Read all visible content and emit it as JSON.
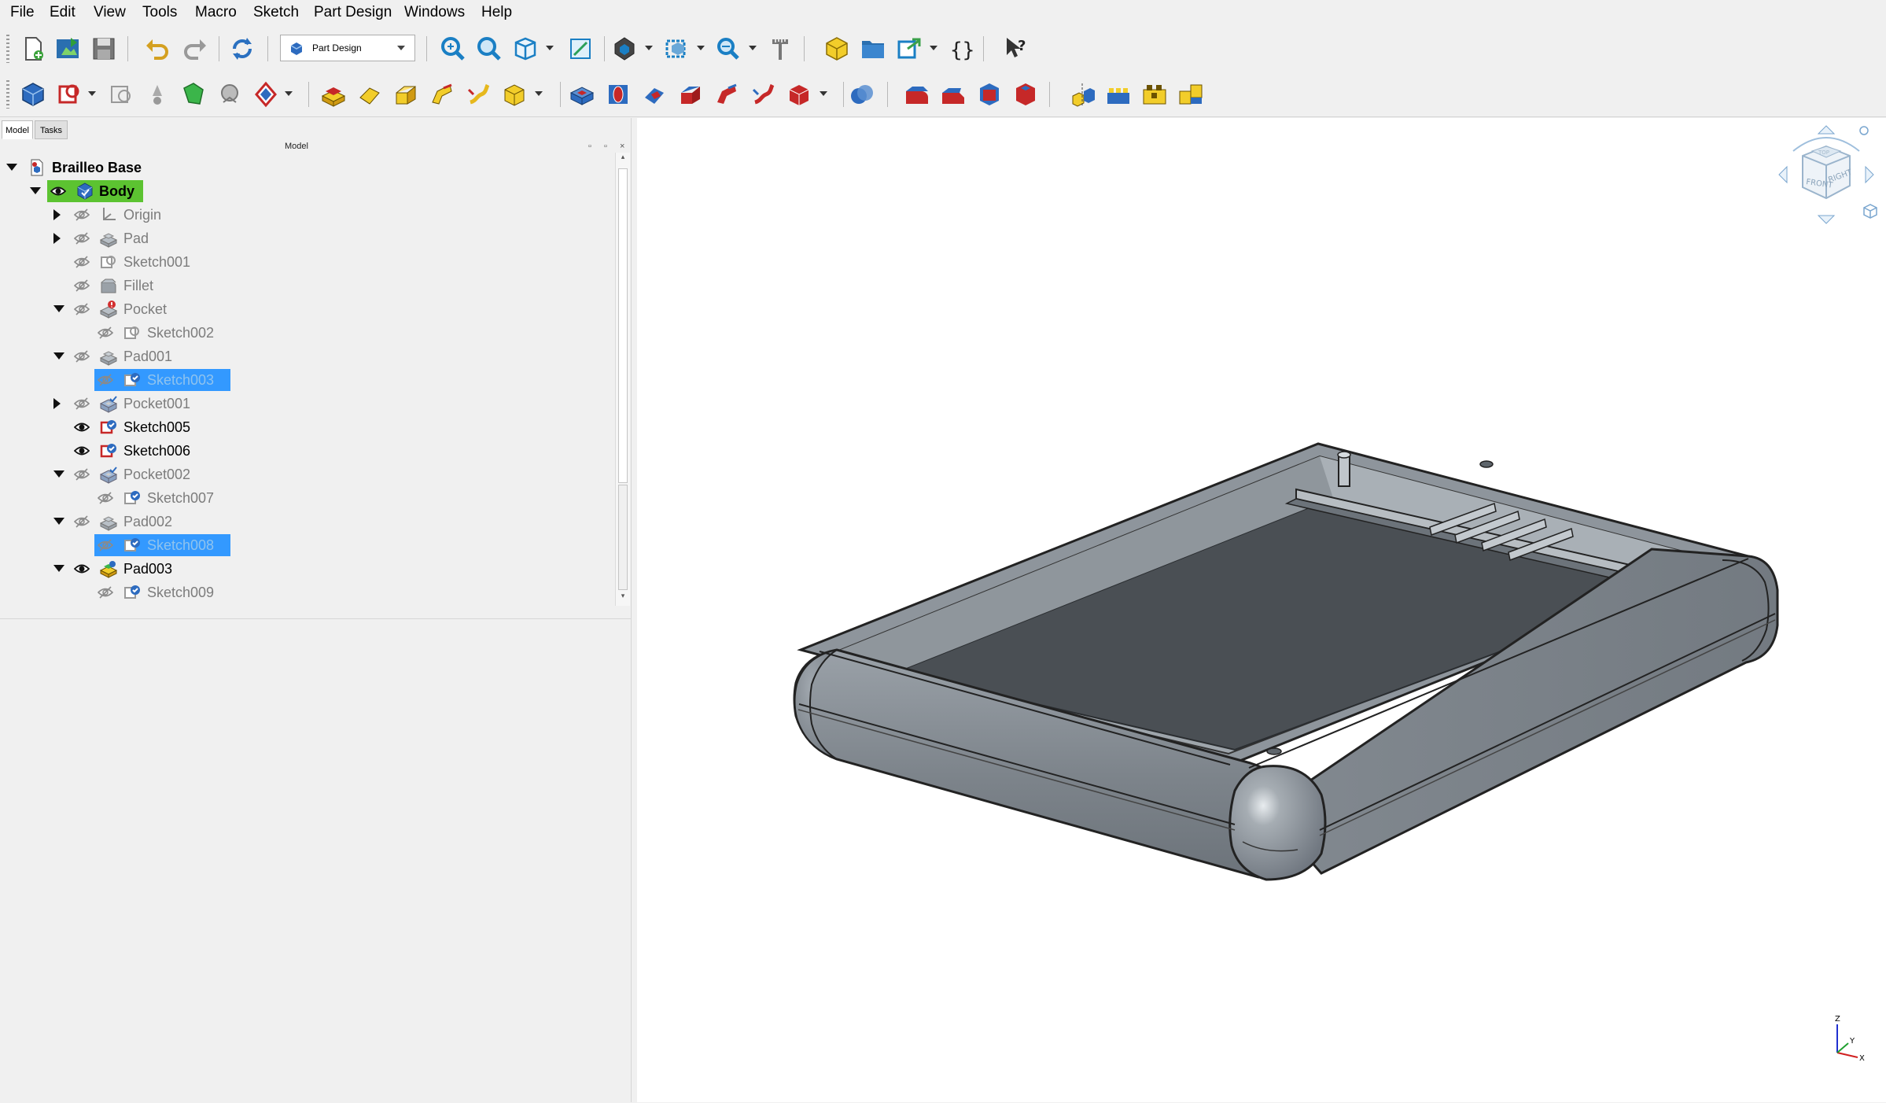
{
  "menu": [
    "File",
    "Edit",
    "View",
    "Tools",
    "Macro",
    "Sketch",
    "Part Design",
    "Windows",
    "Help"
  ],
  "workbench": {
    "selected": "Part Design"
  },
  "panel": {
    "tabs": [
      "Model",
      "Tasks"
    ],
    "title": "Model",
    "controls": [
      "▫",
      "▫",
      "×"
    ]
  },
  "tree": [
    {
      "label": "Brailleo Base",
      "level": 0,
      "expander": "open",
      "icon": "document-icon",
      "visibility": "none",
      "style": "bold"
    },
    {
      "label": "Body",
      "level": 1,
      "expander": "open",
      "icon": "body-icon",
      "visibility": "visible",
      "style": "bold",
      "highlight": "active"
    },
    {
      "label": "Origin",
      "level": 2,
      "expander": "closed",
      "icon": "origin-icon",
      "visibility": "hidden",
      "style": "dim"
    },
    {
      "label": "Pad",
      "level": 2,
      "expander": "closed",
      "icon": "pad-icon",
      "visibility": "hidden",
      "style": "dim"
    },
    {
      "label": "Sketch001",
      "level": 2,
      "expander": "none",
      "icon": "sketch-icon",
      "visibility": "hidden",
      "style": "dim"
    },
    {
      "label": "Fillet",
      "level": 2,
      "expander": "none",
      "icon": "fillet-icon",
      "visibility": "hidden",
      "style": "dim"
    },
    {
      "label": "Pocket",
      "level": 2,
      "expander": "open",
      "icon": "pocket-error-icon",
      "visibility": "hidden",
      "style": "dim"
    },
    {
      "label": "Sketch002",
      "level": 3,
      "expander": "none",
      "icon": "sketch-icon",
      "visibility": "hidden",
      "style": "dim"
    },
    {
      "label": "Pad001",
      "level": 2,
      "expander": "open",
      "icon": "pad-icon",
      "visibility": "hidden",
      "style": "dim"
    },
    {
      "label": "Sketch003",
      "level": 3,
      "expander": "none",
      "icon": "sketch-check-icon",
      "visibility": "hidden",
      "style": "dim",
      "highlight": "selected"
    },
    {
      "label": "Pocket001",
      "level": 2,
      "expander": "closed",
      "icon": "pocket-icon",
      "visibility": "hidden",
      "style": "dim"
    },
    {
      "label": "Sketch005",
      "level": 2,
      "expander": "none",
      "icon": "sketch-red-icon",
      "visibility": "visible",
      "style": "normal"
    },
    {
      "label": "Sketch006",
      "level": 2,
      "expander": "none",
      "icon": "sketch-red-icon",
      "visibility": "visible",
      "style": "normal"
    },
    {
      "label": "Pocket002",
      "level": 2,
      "expander": "open",
      "icon": "pocket-icon",
      "visibility": "hidden",
      "style": "dim"
    },
    {
      "label": "Sketch007",
      "level": 3,
      "expander": "none",
      "icon": "sketch-check-icon",
      "visibility": "hidden",
      "style": "dim"
    },
    {
      "label": "Pad002",
      "level": 2,
      "expander": "open",
      "icon": "pad-icon",
      "visibility": "hidden",
      "style": "dim"
    },
    {
      "label": "Sketch008",
      "level": 3,
      "expander": "none",
      "icon": "sketch-check-icon",
      "visibility": "hidden",
      "style": "dim",
      "highlight": "selected"
    },
    {
      "label": "Pad003",
      "level": 2,
      "expander": "open",
      "icon": "pad-tip-icon",
      "visibility": "visible",
      "style": "normal"
    },
    {
      "label": "Sketch009",
      "level": 3,
      "expander": "none",
      "icon": "sketch-check-icon",
      "visibility": "hidden",
      "style": "dim"
    }
  ],
  "navcube": {
    "front": "FRONT",
    "right": "RIGHT",
    "top": "TOP"
  },
  "axes": {
    "x": "X",
    "y": "Y",
    "z": "Z"
  },
  "colors": {
    "active_body": "#5cc331",
    "selection": "#3399ff",
    "model": "#8c9399"
  }
}
